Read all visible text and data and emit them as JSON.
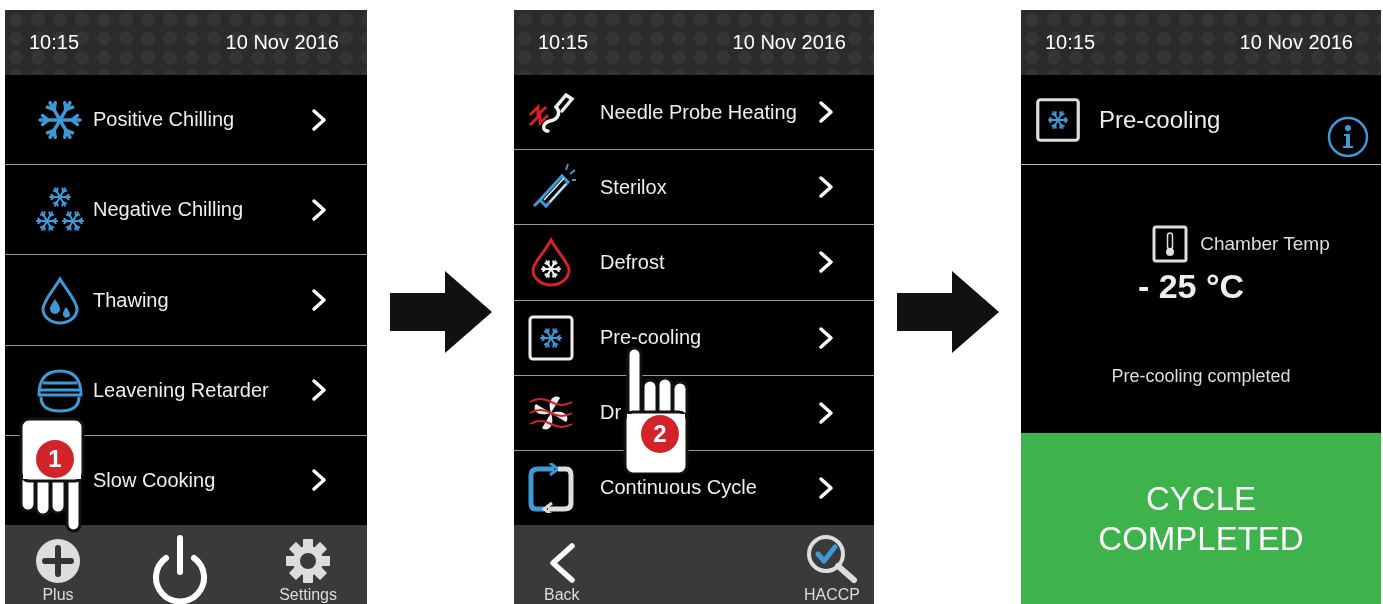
{
  "screens": [
    {
      "time": "10:15",
      "date": "10 Nov 2016",
      "items": [
        {
          "label": "Positive Chilling"
        },
        {
          "label": "Negative Chilling"
        },
        {
          "label": "Thawing"
        },
        {
          "label": "Leavening Retarder"
        },
        {
          "label": "Slow Cooking"
        }
      ],
      "bottom": [
        {
          "kind": "plus",
          "label": "Plus"
        },
        {
          "kind": "power"
        },
        {
          "kind": "gear",
          "label": "Settings"
        }
      ],
      "tap": {
        "number": "1"
      }
    },
    {
      "time": "10:15",
      "date": "10 Nov 2016",
      "items": [
        {
          "label": "Needle Probe Heating"
        },
        {
          "label": "Sterilox"
        },
        {
          "label": "Defrost"
        },
        {
          "label": "Pre-cooling"
        },
        {
          "label": "Dr"
        },
        {
          "label": "Continuous Cycle"
        }
      ],
      "bottom": [
        {
          "kind": "back",
          "label": "Back"
        },
        {
          "kind": "haccp",
          "label": "HACCP"
        }
      ],
      "tap": {
        "number": "2"
      }
    }
  ],
  "detail": {
    "time": "10:15",
    "date": "10 Nov 2016",
    "title": "Pre-cooling",
    "sensor_label": "Chamber Temp",
    "reading": "- 25 °C",
    "message": "Pre-cooling completed",
    "banner": "CYCLE COMPLETED"
  }
}
